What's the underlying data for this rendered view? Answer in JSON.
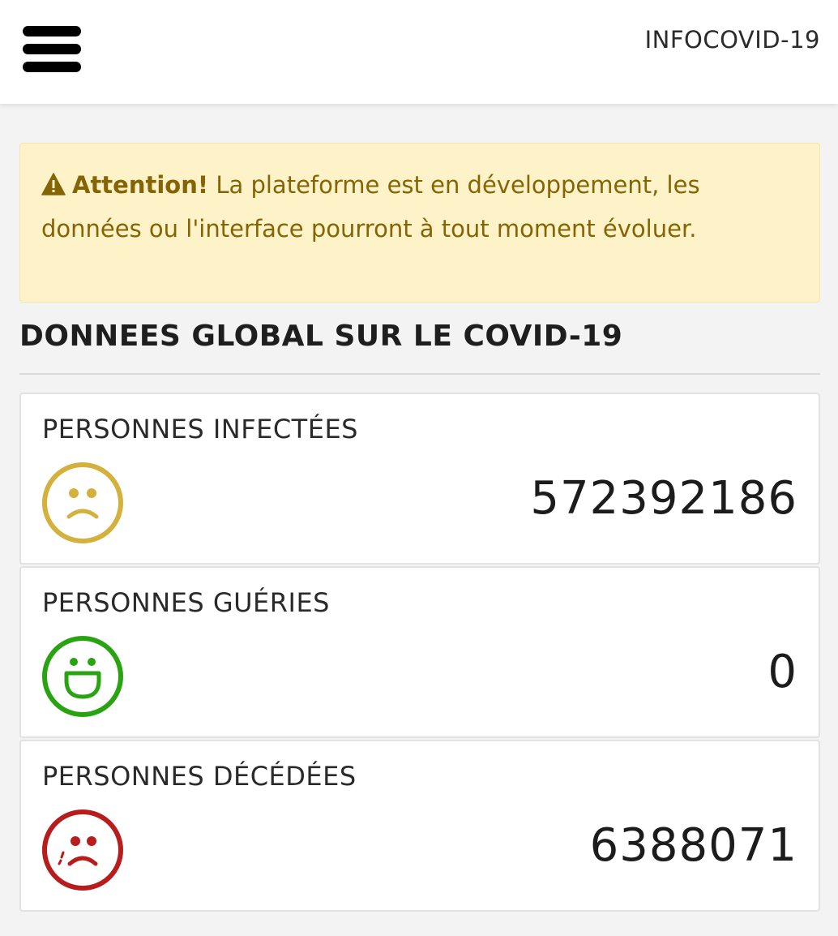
{
  "header": {
    "brand": "INFOCOVID-19",
    "menu_icon": "hamburger-menu-icon"
  },
  "alert": {
    "icon": "warning-triangle-icon",
    "title": "Attention!",
    "message": "La plateforme est en développement, les données ou l'interface pourront à tout moment évoluer.",
    "colors": {
      "background": "#fdf2c8",
      "text": "#856404"
    }
  },
  "section": {
    "title": "DONNEES GLOBAL SUR LE COVID-19"
  },
  "stats": [
    {
      "label": "PERSONNES INFECTÉES",
      "value": "572392186",
      "icon": "sad-face-icon",
      "color": "#d4b03c"
    },
    {
      "label": "PERSONNES GUÉRIES",
      "value": "0",
      "icon": "grin-face-icon",
      "color": "#2aa312"
    },
    {
      "label": "PERSONNES DÉCÉDÉES",
      "value": "6388071",
      "icon": "crying-face-icon",
      "color": "#b81c1c"
    }
  ]
}
